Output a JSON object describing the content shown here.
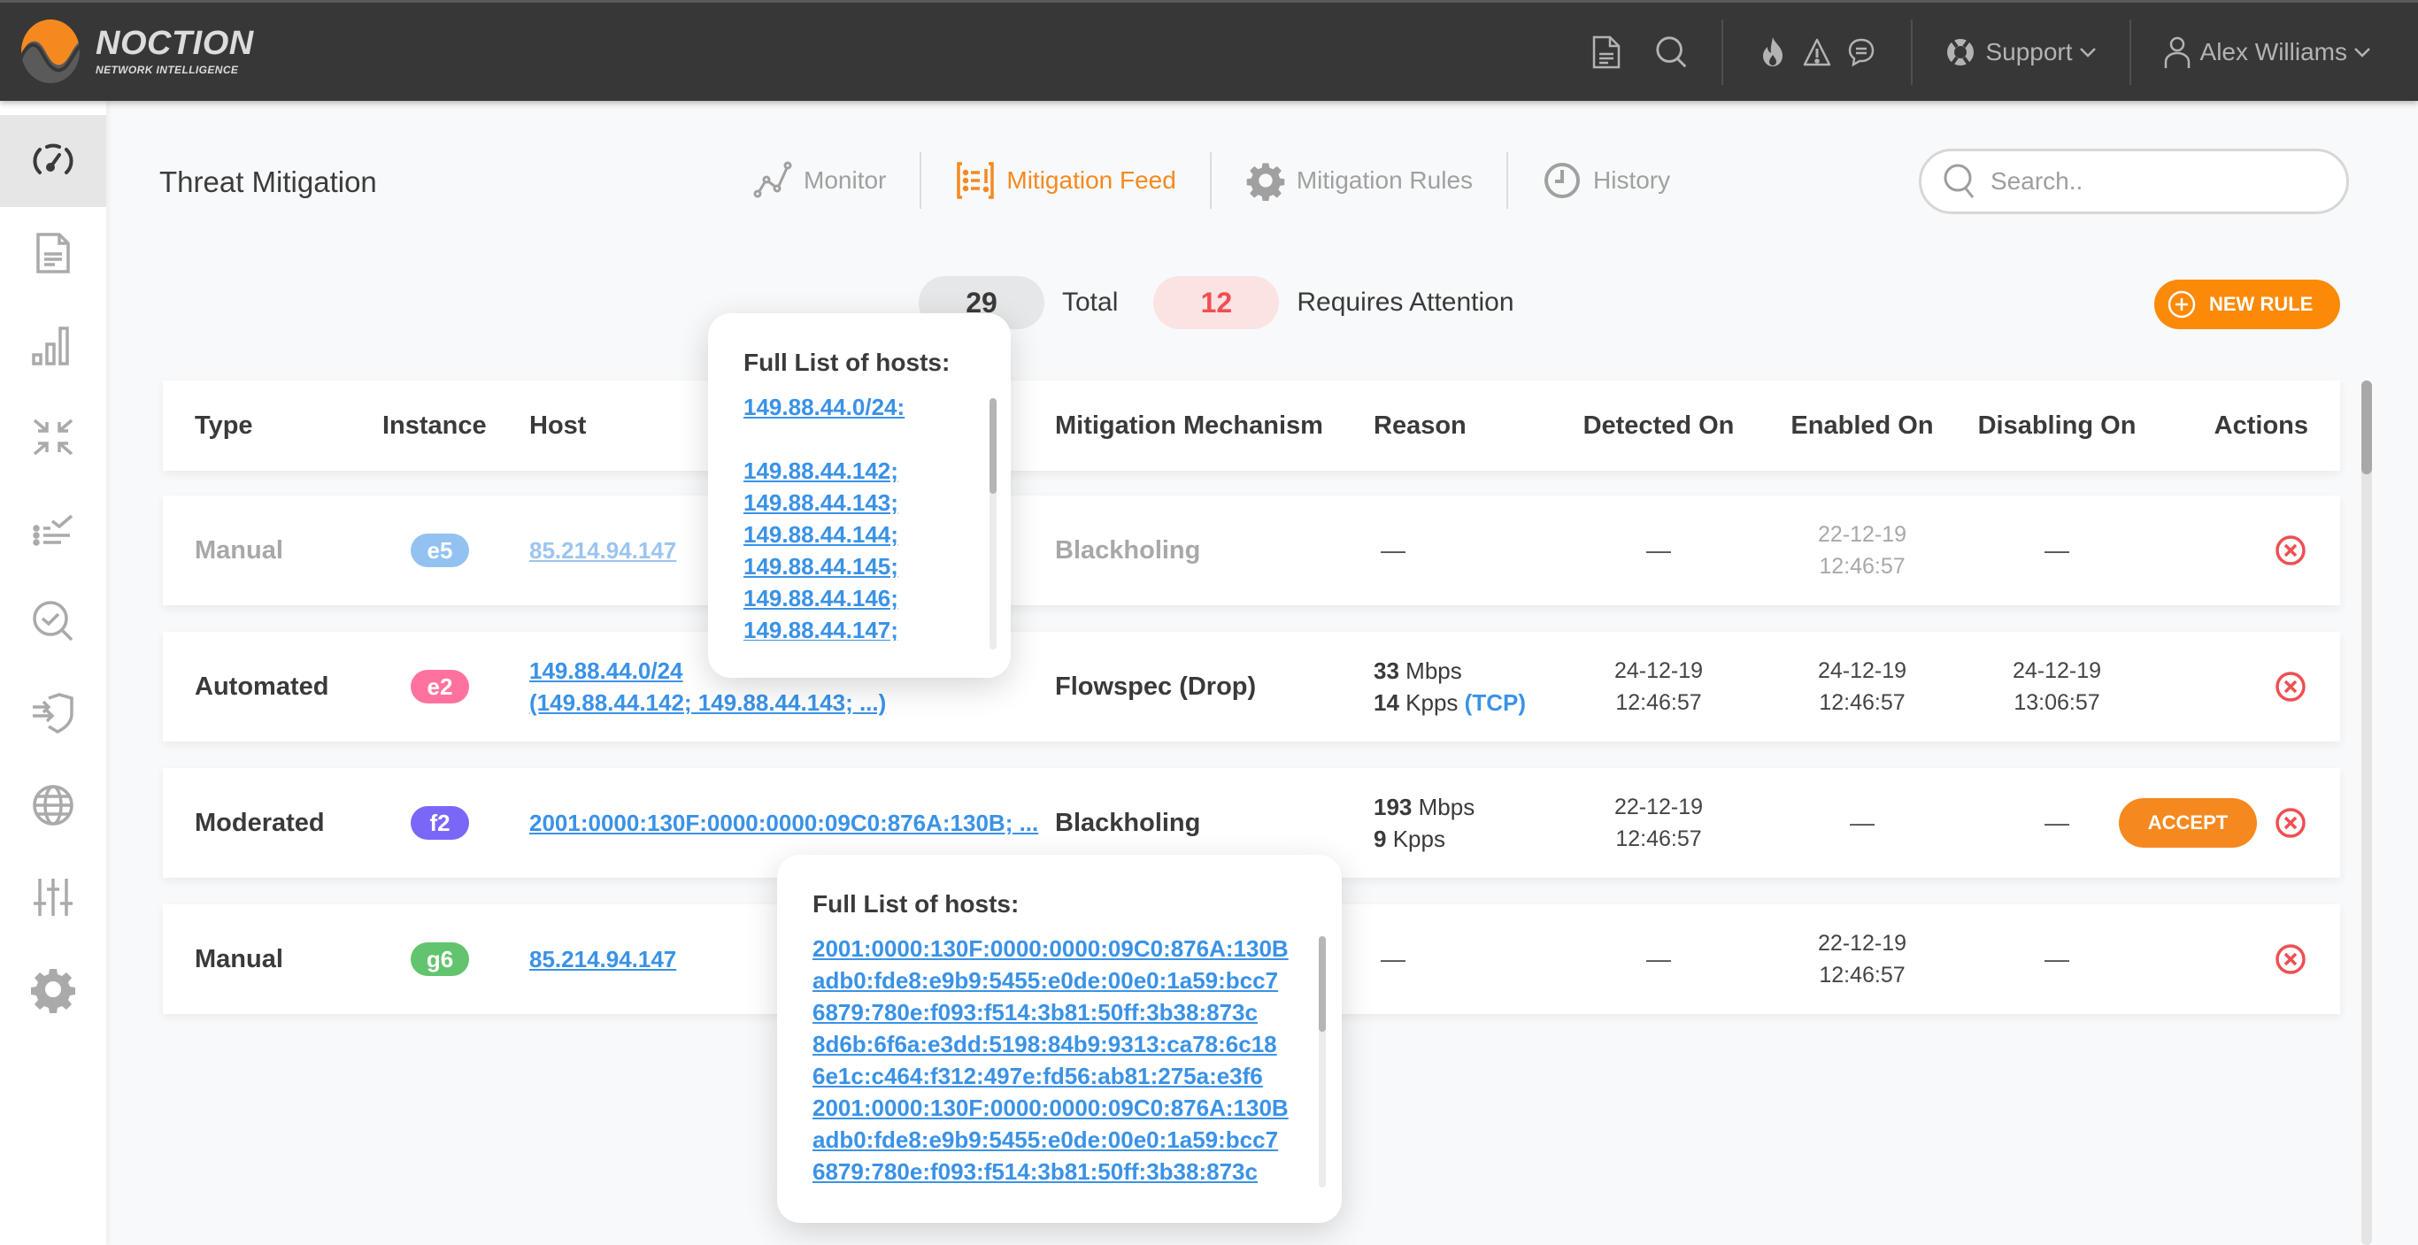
{
  "app": {
    "brand": "NOCTION",
    "brand_sub": "NETWORK INTELLIGENCE"
  },
  "topbar": {
    "icons": [
      "document-icon",
      "search-icon",
      "fire-icon",
      "warning-icon",
      "chat-icon"
    ],
    "support_label": "Support",
    "user_name": "Alex Williams"
  },
  "sidebar": {
    "items": [
      {
        "name": "dashboard",
        "icon": "speedometer-icon",
        "active": true
      },
      {
        "name": "reports",
        "icon": "document-icon",
        "active": false
      },
      {
        "name": "statistics",
        "icon": "bar-chart-icon",
        "active": false
      },
      {
        "name": "collapse",
        "icon": "arrows-inward-icon",
        "active": false
      },
      {
        "name": "tasks",
        "icon": "checklist-icon",
        "active": false
      },
      {
        "name": "inspect",
        "icon": "search-check-icon",
        "active": false
      },
      {
        "name": "threat-mitigation",
        "icon": "shield-arrows-icon",
        "active": false
      },
      {
        "name": "global",
        "icon": "globe-icon",
        "active": false
      },
      {
        "name": "tuning",
        "icon": "sliders-icon",
        "active": false
      },
      {
        "name": "settings",
        "icon": "gear-icon",
        "active": false
      }
    ]
  },
  "page": {
    "title": "Threat Mitigation",
    "tabs": [
      {
        "label": "Monitor",
        "icon": "graph-icon",
        "active": false
      },
      {
        "label": "Mitigation Feed",
        "icon": "feed-list-icon",
        "active": true
      },
      {
        "label": "Mitigation Rules",
        "icon": "gear-icon",
        "active": false
      },
      {
        "label": "History",
        "icon": "clock-icon",
        "active": false
      }
    ],
    "search_placeholder": "Search.."
  },
  "stats": {
    "total_value": "29",
    "total_label": "Total",
    "attention_value": "12",
    "attention_label": "Requires Attention"
  },
  "new_rule_label": "NEW RULE",
  "colors": {
    "accent": "#f5891f",
    "danger": "#ef4f53",
    "link": "#3a92e6"
  },
  "table": {
    "headers": [
      "Type",
      "Instance",
      "Host",
      "Mitigation Mechanism",
      "Reason",
      "Detected On",
      "Enabled On",
      "Disabling On",
      "Actions"
    ],
    "rows": [
      {
        "type": "Manual",
        "instance": "e5",
        "instance_color": "#93c2f1",
        "host_line1": "85.214.94.147",
        "host_line2": "",
        "mechanism": "Blackholing",
        "reason_rate": "",
        "reason_rate_unit": "",
        "reason_pkts": "",
        "reason_pkts_unit": "",
        "reason_proto": "",
        "reason_dash": "—",
        "detected": [
          "—"
        ],
        "enabled": [
          "22-12-19",
          "12:46:57"
        ],
        "disabling": [
          "—"
        ],
        "muted": true,
        "accept_label": ""
      },
      {
        "type": "Automated",
        "instance": "e2",
        "instance_color": "#ff72a0",
        "host_line1": "149.88.44.0/24",
        "host_line2": "(149.88.44.142; 149.88.44.143; ...)",
        "mechanism": "Flowspec (Drop)",
        "reason_rate": "33",
        "reason_rate_unit": "Mbps",
        "reason_pkts": "14",
        "reason_pkts_unit": "Kpps",
        "reason_proto": "(TCP)",
        "reason_dash": "",
        "detected": [
          "24-12-19",
          "12:46:57"
        ],
        "enabled": [
          "24-12-19",
          "12:46:57"
        ],
        "disabling": [
          "24-12-19",
          "13:06:57"
        ],
        "muted": false,
        "accept_label": ""
      },
      {
        "type": "Moderated",
        "instance": "f2",
        "instance_color": "#7a67f8",
        "host_line1": "2001:0000:130F:0000:0000:09C0:876A:130B; ...",
        "host_line2": "",
        "mechanism": "Blackholing",
        "reason_rate": "193",
        "reason_rate_unit": "Mbps",
        "reason_pkts": "9",
        "reason_pkts_unit": "Kpps",
        "reason_proto": "",
        "reason_dash": "",
        "detected": [
          "22-12-19",
          "12:46:57"
        ],
        "enabled": [
          "—"
        ],
        "disabling": [
          "—"
        ],
        "muted": false,
        "accept_label": "ACCEPT"
      },
      {
        "type": "Manual",
        "instance": "g6",
        "instance_color": "#62c46e",
        "host_line1": "85.214.94.147",
        "host_line2": "",
        "mechanism": "",
        "reason_rate": "",
        "reason_rate_unit": "",
        "reason_pkts": "",
        "reason_pkts_unit": "",
        "reason_proto": "",
        "reason_dash": "—",
        "detected": [
          "—"
        ],
        "enabled": [
          "22-12-19",
          "12:46:57"
        ],
        "disabling": [
          "—"
        ],
        "muted": false,
        "accept_label": ""
      }
    ]
  },
  "popover_ipv4": {
    "title": "Full List of hosts:",
    "items": [
      "149.88.44.0/24:",
      "",
      "149.88.44.142;",
      "149.88.44.143;",
      "149.88.44.144;",
      "149.88.44.145;",
      "149.88.44.146;",
      "149.88.44.147;"
    ]
  },
  "popover_ipv6": {
    "title": "Full List of hosts:",
    "items": [
      "2001:0000:130F:0000:0000:09C0:876A:130B",
      "adb0:fde8:e9b9:5455:e0de:00e0:1a59:bcc7",
      "6879:780e:f093:f514:3b81:50ff:3b38:873c",
      "8d6b:6f6a:e3dd:5198:84b9:9313:ca78:6c18",
      "6e1c:c464:f312:497e:fd56:ab81:275a:e3f6",
      "2001:0000:130F:0000:0000:09C0:876A:130B",
      "adb0:fde8:e9b9:5455:e0de:00e0:1a59:bcc7",
      "6879:780e:f093:f514:3b81:50ff:3b38:873c"
    ]
  }
}
